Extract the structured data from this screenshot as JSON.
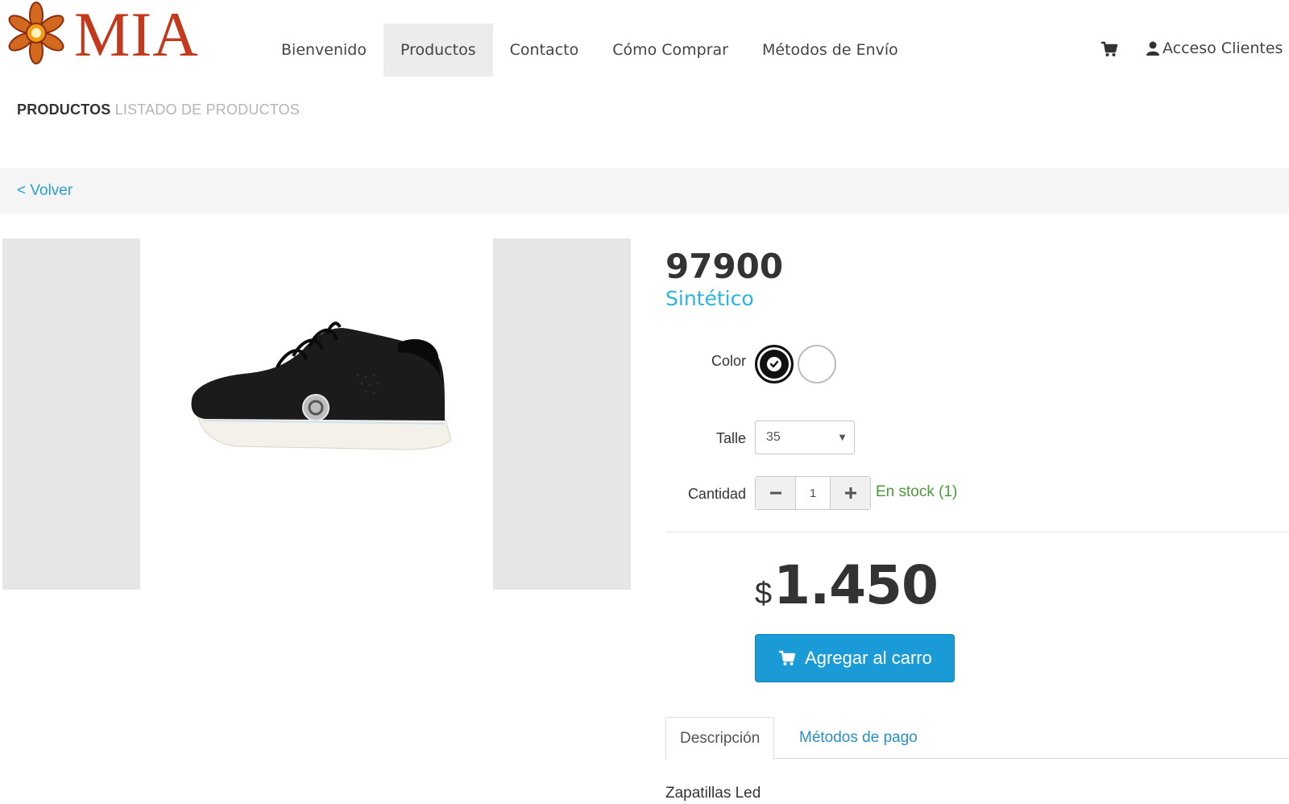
{
  "header": {
    "logo_text": "MIA",
    "nav": [
      "Bienvenido",
      "Productos",
      "Contacto",
      "Cómo Comprar",
      "Métodos de Envío"
    ],
    "active_nav": "Productos",
    "account_label": "Acceso Clientes"
  },
  "breadcrumb": {
    "section": "PRODUCTOS",
    "subsection": "LISTADO DE PRODUCTOS"
  },
  "back_link": "< Volver",
  "product": {
    "sku": "97900",
    "material": "Sintético",
    "color_label": "Color",
    "colors": [
      {
        "name": "negro",
        "hex": "#111111",
        "selected": true
      },
      {
        "name": "blanco",
        "hex": "#ffffff",
        "selected": false
      }
    ],
    "size_label": "Talle",
    "size_value": "35",
    "quantity_label": "Cantidad",
    "quantity_value": "1",
    "stock_text": "En stock (1)",
    "price_currency": "$",
    "price_amount": "1.450",
    "add_to_cart_label": "Agregar al carro",
    "accent_color": "#1a9bd7"
  },
  "tabs": {
    "items": [
      "Descripción",
      "Métodos de pago"
    ],
    "active": "Descripción"
  },
  "description": "Zapatillas Led"
}
